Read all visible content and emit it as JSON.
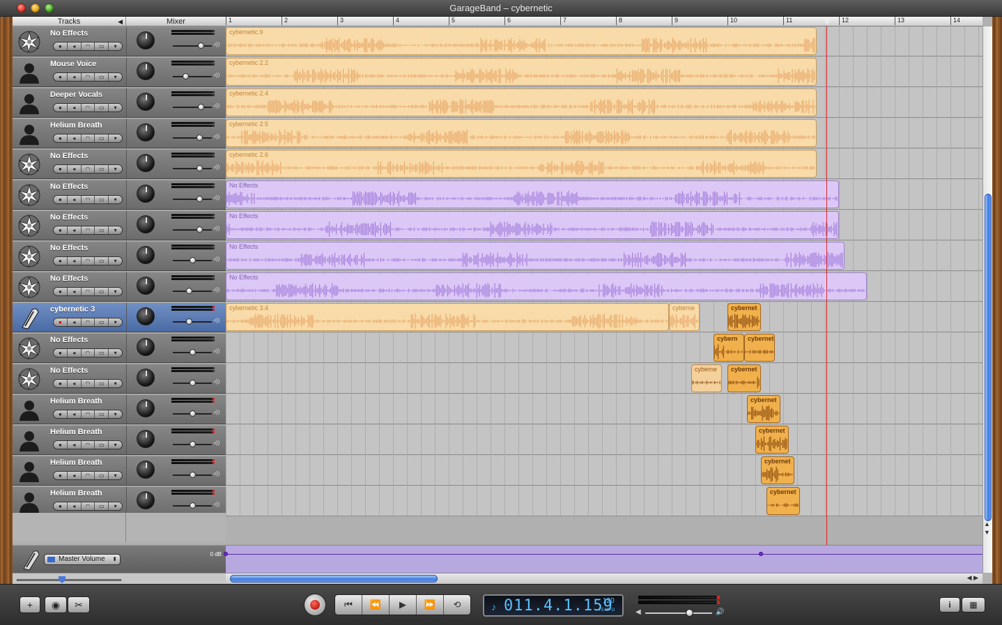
{
  "window": {
    "title": "GarageBand – cybernetic"
  },
  "headers": {
    "tracks": "Tracks",
    "mixer": "Mixer"
  },
  "ruler": {
    "bars": [
      "1",
      "2",
      "3",
      "4",
      "5",
      "6",
      "7",
      "8",
      "9",
      "10",
      "11",
      "12",
      "13",
      "14"
    ]
  },
  "tracks": [
    {
      "name": "No Effects",
      "icon": "star-burst-icon",
      "vol": 0.75
    },
    {
      "name": "Mouse Voice",
      "icon": "person-silhouette-icon",
      "vol": 0.3
    },
    {
      "name": "Deeper Vocals",
      "icon": "person-silhouette-icon",
      "vol": 0.75
    },
    {
      "name": "Helium Breath",
      "icon": "person-silhouette-icon",
      "vol": 0.7
    },
    {
      "name": "No Effects",
      "icon": "star-burst-icon",
      "vol": 0.7
    },
    {
      "name": "No Effects",
      "icon": "star-burst-icon",
      "vol": 0.7
    },
    {
      "name": "No Effects",
      "icon": "star-burst-icon",
      "vol": 0.7
    },
    {
      "name": "No Effects",
      "icon": "star-burst-icon",
      "vol": 0.5
    },
    {
      "name": "No Effects",
      "icon": "star-burst-icon",
      "vol": 0.4
    },
    {
      "name": "cybernetic 3",
      "icon": "microphone-icon",
      "vol": 0.4,
      "selected": true
    },
    {
      "name": "No Effects",
      "icon": "star-burst-icon",
      "vol": 0.5
    },
    {
      "name": "No Effects",
      "icon": "star-burst-icon",
      "vol": 0.5
    },
    {
      "name": "Helium Breath",
      "icon": "person-silhouette-icon",
      "vol": 0.5
    },
    {
      "name": "Helium Breath",
      "icon": "person-silhouette-icon",
      "vol": 0.5
    },
    {
      "name": "Helium Breath",
      "icon": "person-silhouette-icon",
      "vol": 0.5
    },
    {
      "name": "Helium Breath",
      "icon": "person-silhouette-icon",
      "vol": 0.5
    }
  ],
  "regions": [
    {
      "track": 0,
      "label": "cybernetic.9",
      "kind": "orange",
      "start": 1.0,
      "end": 11.6
    },
    {
      "track": 1,
      "label": "cybernetic 2.2",
      "kind": "orange",
      "start": 1.0,
      "end": 11.6
    },
    {
      "track": 2,
      "label": "cybernetic 2.4",
      "kind": "orange",
      "start": 1.0,
      "end": 11.6
    },
    {
      "track": 3,
      "label": "cybernetic 2.5",
      "kind": "orange",
      "start": 1.0,
      "end": 11.6
    },
    {
      "track": 4,
      "label": "cybernetic 2.6",
      "kind": "orange",
      "start": 1.0,
      "end": 11.6
    },
    {
      "track": 5,
      "label": "No Effects",
      "kind": "purple",
      "start": 1.0,
      "end": 12.0
    },
    {
      "track": 6,
      "label": "No Effects",
      "kind": "purple",
      "start": 1.0,
      "end": 12.0
    },
    {
      "track": 7,
      "label": "No Effects",
      "kind": "purple",
      "start": 1.0,
      "end": 12.1
    },
    {
      "track": 8,
      "label": "No Effects",
      "kind": "purple",
      "start": 1.0,
      "end": 12.5
    },
    {
      "track": 9,
      "label": "cybernetic 3.4",
      "kind": "orange",
      "start": 1.0,
      "end": 8.95
    },
    {
      "track": 9,
      "label": "cyberne",
      "kind": "orange",
      "start": 8.95,
      "end": 9.5
    },
    {
      "track": 9,
      "label": "cybernet",
      "kind": "small",
      "start": 10.0,
      "end": 10.6
    },
    {
      "track": 10,
      "label": "cybern",
      "kind": "small",
      "start": 9.75,
      "end": 10.3
    },
    {
      "track": 10,
      "label": "cybernet",
      "kind": "small",
      "start": 10.3,
      "end": 10.85
    },
    {
      "track": 11,
      "label": "cyberne",
      "kind": "small-light",
      "start": 9.35,
      "end": 9.9
    },
    {
      "track": 11,
      "label": "cybernet",
      "kind": "small",
      "start": 10.0,
      "end": 10.6
    },
    {
      "track": 12,
      "label": "cybernet",
      "kind": "small",
      "start": 10.35,
      "end": 10.95
    },
    {
      "track": 13,
      "label": "cybernet",
      "kind": "small",
      "start": 10.5,
      "end": 11.1
    },
    {
      "track": 14,
      "label": "cybernet",
      "kind": "small",
      "start": 10.6,
      "end": 11.2
    },
    {
      "track": 15,
      "label": "cybernet",
      "kind": "small",
      "start": 10.7,
      "end": 11.3
    }
  ],
  "master": {
    "select": "Master Volume",
    "db": "0 dB",
    "points": [
      1.0,
      10.6
    ]
  },
  "transport": {
    "prev": "⏮",
    "rewind": "⏪",
    "play": "▶",
    "forward": "⏩",
    "cycle": "⟲",
    "time": "011.4.1.159",
    "bpm": "120",
    "tempo": "TEMPO",
    "note": "♪"
  },
  "toolbar": {
    "add": "+",
    "eye": "◉",
    "scissors": "✂",
    "info": "i",
    "media": "▦"
  },
  "colors": {
    "orange_region": "#f8dba8",
    "purple_region": "#dcc8f6",
    "playhead": "#e02020",
    "scroll_blue": "#3e7ae0"
  }
}
